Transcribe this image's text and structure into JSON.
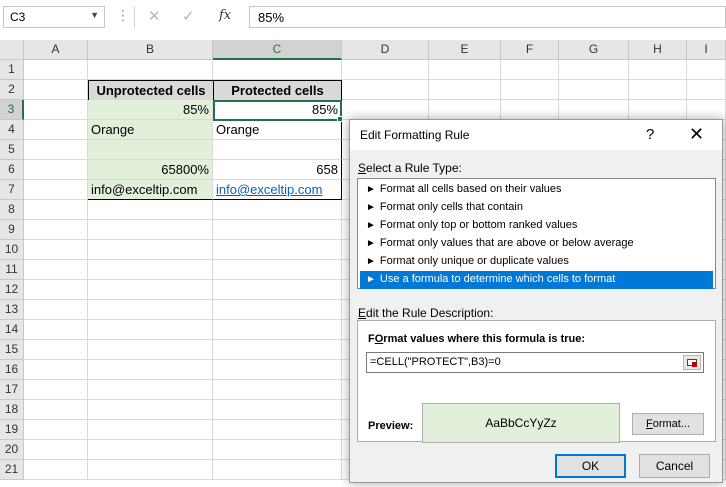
{
  "formula_bar": {
    "name_box": "C3",
    "cancel_glyph": "✕",
    "enter_glyph": "✓",
    "fx_label": "fx",
    "value": "85%"
  },
  "columns": [
    "A",
    "B",
    "C",
    "D",
    "E",
    "F",
    "G",
    "H",
    "I"
  ],
  "rows": [
    "1",
    "2",
    "3",
    "4",
    "5",
    "6",
    "7",
    "8",
    "9",
    "10",
    "11",
    "12",
    "13",
    "14",
    "15",
    "16",
    "17",
    "18",
    "19",
    "20",
    "21"
  ],
  "selected_cell": "C3",
  "table": {
    "header_b": "Unprotected cells",
    "header_c": "Protected cells",
    "b3": "85%",
    "c3": "85%",
    "b4": "Orange",
    "c4": "Orange",
    "b6": "65800%",
    "c6": "658",
    "b7": "info@exceltip.com",
    "c7": "info@exceltip.com"
  },
  "dialog": {
    "title": "Edit Formatting Rule",
    "help": "?",
    "close": "✕",
    "select_rule_type_u": "S",
    "select_rule_type": "elect a Rule Type:",
    "rule_types": [
      "Format all cells based on their values",
      "Format only cells that contain",
      "Format only top or bottom ranked values",
      "Format only values that are above or below average",
      "Format only unique or duplicate values",
      "Use a formula to determine which cells to format"
    ],
    "selected_rule_index": 5,
    "edit_desc_u": "E",
    "edit_desc": "dit the Rule Description:",
    "formula_label_u": "O",
    "formula_label_pre": "F",
    "formula_label_post": "rmat values where this formula is true:",
    "formula": "=CELL(\"PROTECT\",B3)=0",
    "preview_label": "Preview:",
    "preview_text": "AaBbCcYyZz",
    "format_button_u": "F",
    "format_button": "ormat...",
    "ok": "OK",
    "cancel": "Cancel"
  },
  "colors": {
    "accent": "#217346",
    "green_fill": "#e2efda",
    "header_fill": "#d9d9d9",
    "selection_blue": "#0078d7",
    "link": "#0563c1"
  }
}
